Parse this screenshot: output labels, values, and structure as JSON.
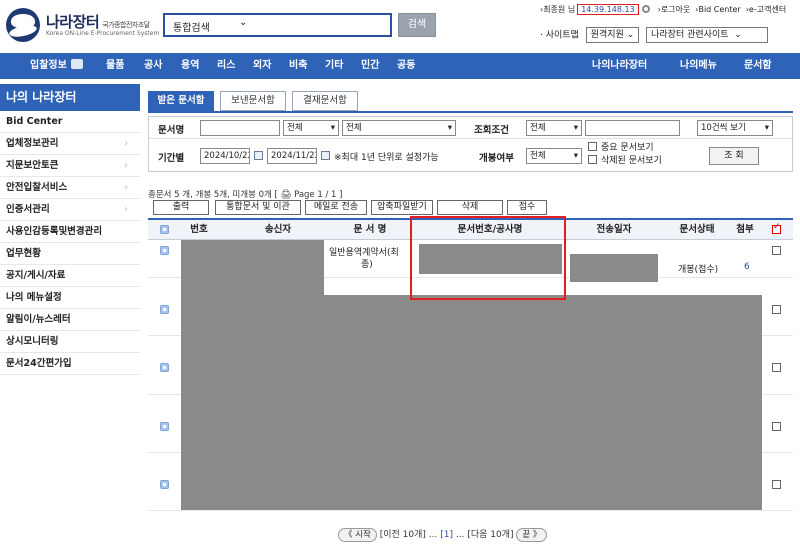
{
  "header": {
    "logo_title": "나라장터",
    "logo_subtitle": "국가종합전자조달",
    "logo_english": "Korea ON-Line E-Procurement System",
    "search_select": "통합검색",
    "search_button": "검색",
    "user_prefix": "›최종원 님",
    "ip": "14.39.148.13",
    "logout": "›로그아웃",
    "bid_center": "›Bid Center",
    "customer_center": "›e-고객센터",
    "site_map": "· 사이트맵",
    "remote_support": "원격지원",
    "related_sites": "나라장터 관련사이트"
  },
  "nav": {
    "items": [
      "입찰정보",
      "물품",
      "공사",
      "용역",
      "리스",
      "외자",
      "비축",
      "기타",
      "민간",
      "공동"
    ],
    "right_items": [
      "나의나라장터",
      "나의메뉴",
      "문서함"
    ]
  },
  "sidebar": {
    "title": "나의 나라장터",
    "items": [
      {
        "label": "Bid Center",
        "arrow": false
      },
      {
        "label": "업체정보관리",
        "arrow": true
      },
      {
        "label": "지문보안토큰",
        "arrow": true
      },
      {
        "label": "안전입찰서비스",
        "arrow": true
      },
      {
        "label": "인증서관리",
        "arrow": true
      },
      {
        "label": "사용인감등록및변경관리",
        "arrow": false
      },
      {
        "label": "업무현황",
        "arrow": false
      },
      {
        "label": "공지/게시/자료",
        "arrow": false
      },
      {
        "label": "나의 메뉴설정",
        "arrow": false
      },
      {
        "label": "알림이/뉴스레터",
        "arrow": false
      },
      {
        "label": "상시모니터링",
        "arrow": false
      },
      {
        "label": "문서24간편가입",
        "arrow": false
      }
    ],
    "arrow_glyph": "›"
  },
  "tabs": [
    "받은 문서함",
    "보낸문서함",
    "결재문서함"
  ],
  "filter": {
    "doc_name_label": "문서명",
    "select_all_1": "전체",
    "select_all_2": "전체",
    "query_cond_label": "조회조건",
    "query_cond_value": "전체",
    "per_page": "10건씩 보기",
    "period_label": "기간별",
    "date_from": "2024/10/22",
    "date_to": "2024/11/22",
    "period_note": "※최대 1년 단위로 설정가능",
    "open_label": "개봉여부",
    "open_value": "전체",
    "important_label": "중요 문서보기",
    "deleted_label": "삭제된 문서보기",
    "search_button": "조 회",
    "caret": "▾"
  },
  "summary": "총문서 5 개, 개봉 5개, 미개봉 0개 [ 🖨 Page 1 / 1 ]",
  "actions": [
    "출력",
    "통합문서 및 이관",
    "메일로 전송",
    "압축파일받기",
    "삭제",
    "접수"
  ],
  "grid": {
    "headers": [
      "번호",
      "송신자",
      "문 서 명",
      "문서번호/공사명",
      "전송일자",
      "문서상태",
      "첨부"
    ],
    "row1": {
      "doc_name_line1": "일반용역계약서(최",
      "doc_name_line2": "종)",
      "status": "개봉(접수)",
      "attach": "6"
    }
  },
  "pager": {
    "start": "《 시작",
    "prev": "[이전 10개]",
    "dots1": "...",
    "current": "[1]",
    "dots2": "...",
    "next": "[다음 10개]",
    "end": "끝 》"
  },
  "colors": {
    "nav_blue": "#2e63b8",
    "highlight_red": "#e02020",
    "redaction_gray": "#8a8a8a"
  }
}
